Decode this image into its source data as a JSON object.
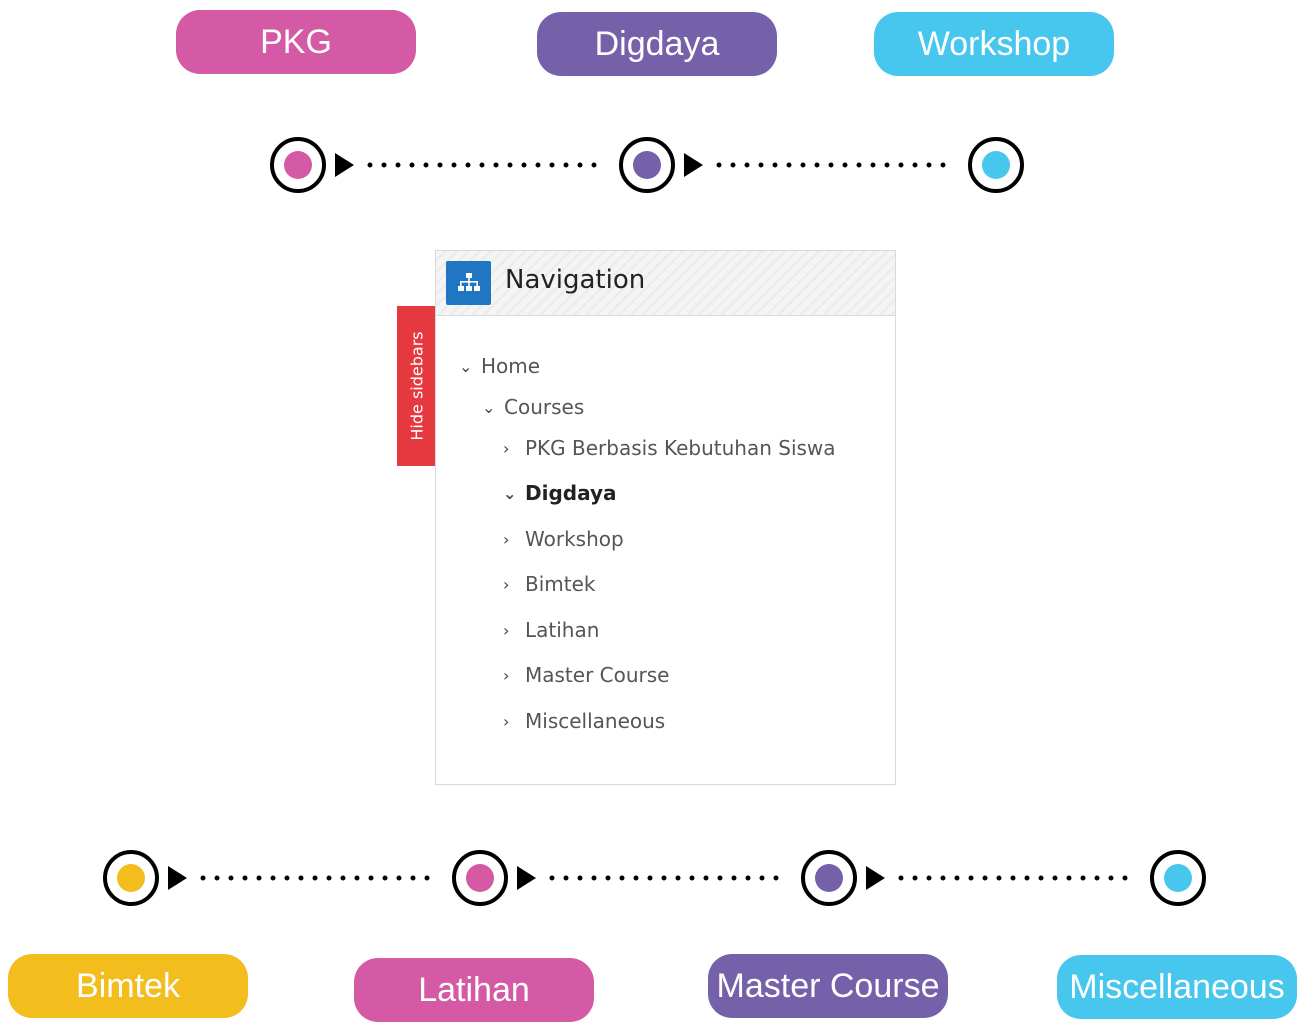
{
  "colors": {
    "pink": "#d45aa5",
    "purple": "#7560aa",
    "cyan": "#47c6ee",
    "yellow": "#f2bd1d",
    "nav_icon_blue": "#1f77c4",
    "hide_tab_red": "#e5393f"
  },
  "top_labels": [
    "PKG",
    "Digdaya",
    "Workshop"
  ],
  "bottom_labels": [
    "Bimtek",
    "Latihan",
    "Master Course",
    "Miscellaneous"
  ],
  "navigation": {
    "title": "Navigation",
    "header_icon": "sitemap-icon",
    "hide_sidebars_label": "Hide sidebars",
    "items": [
      {
        "label": "Home",
        "expanded": true
      },
      {
        "label": "Courses",
        "expanded": true
      },
      {
        "label": "PKG Berbasis Kebutuhan Siswa",
        "expanded": false
      },
      {
        "label": "Digdaya",
        "expanded": true,
        "current": true
      },
      {
        "label": "Workshop",
        "expanded": false
      },
      {
        "label": "Bimtek",
        "expanded": false
      },
      {
        "label": "Latihan",
        "expanded": false
      },
      {
        "label": "Master Course",
        "expanded": false
      },
      {
        "label": "Miscellaneous",
        "expanded": false
      }
    ]
  }
}
